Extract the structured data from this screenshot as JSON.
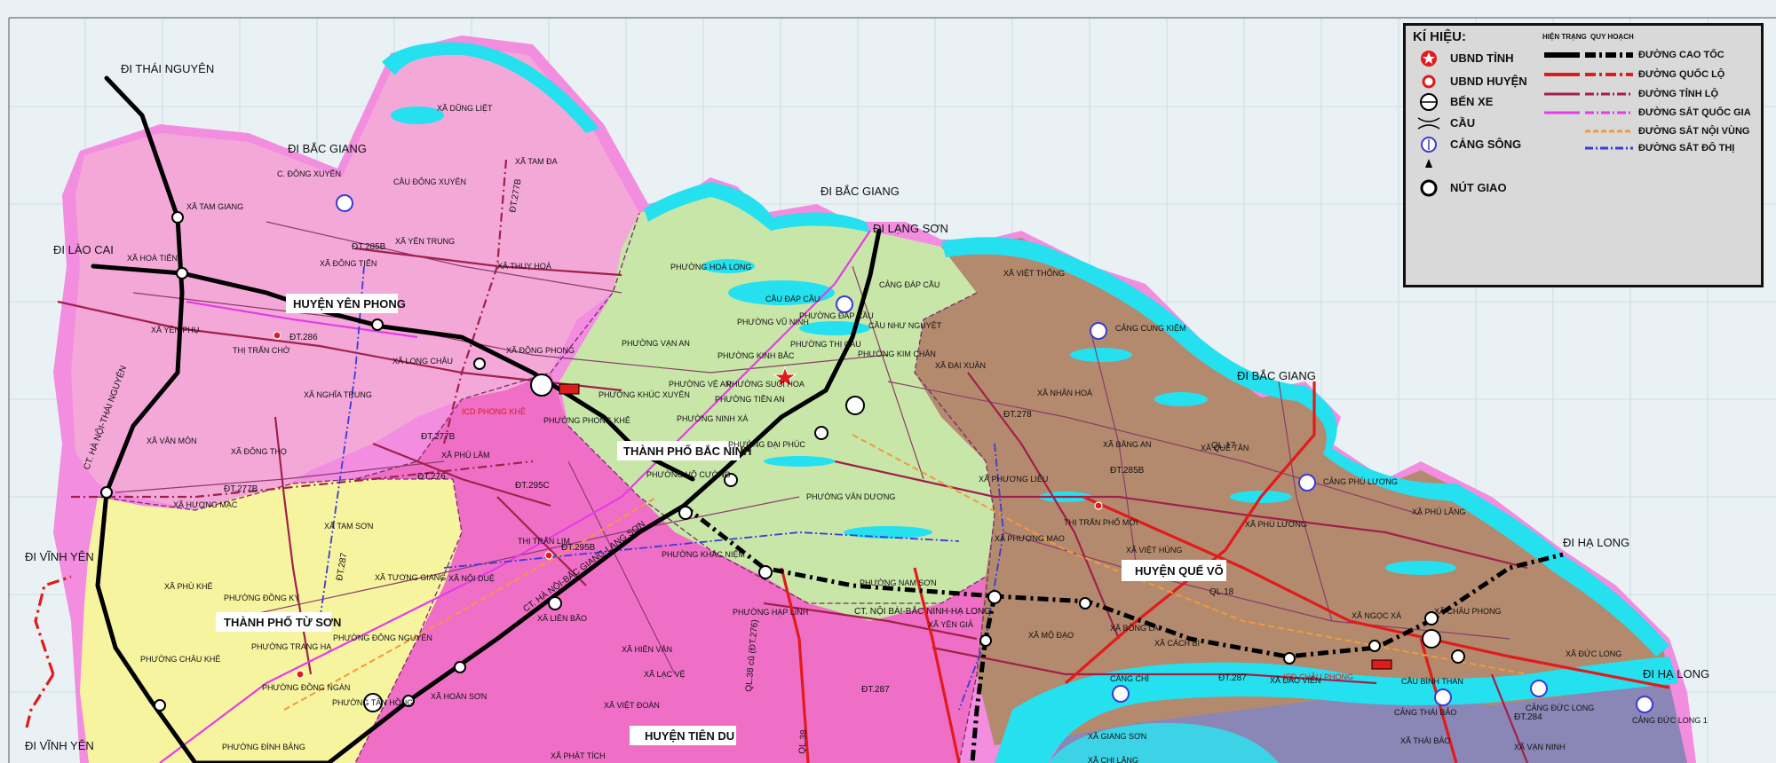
{
  "map": {
    "regions": {
      "yen_phong": "HUYỆN YÊN PHONG",
      "bac_ninh": "THÀNH PHỐ BẮC NINH",
      "tu_son": "THÀNH PHỐ TỪ SƠN",
      "que_vo": "HUYỆN QUẾ VÕ",
      "tien_du": "HUYỆN TIÊN DU"
    },
    "directions": {
      "thai_nguyen": "ĐI THÁI NGUYÊN",
      "bac_giang_1": "ĐI BẮC GIANG",
      "bac_giang_2": "ĐI BẮC GIANG",
      "lang_son": "ĐI LẠNG SƠN",
      "lao_cai": "ĐI LÀO CAI",
      "bac_giang_3": "ĐI BẮC GIANG",
      "vinh_yen_1": "ĐI VĨNH YÊN",
      "vinh_yen_2": "ĐI VĨNH YÊN",
      "ha_long_1": "ĐI HẠ LONG",
      "ha_long_2": "ĐI HẠ LONG"
    },
    "road_labels": {
      "ct_hn_tn": "CT. HÀ NỘI-THÁI NGUYÊN",
      "ct_hn_bg_ls": "CT. HÀ NỘI-BẮC GIANG-LẠNG SƠN",
      "ct_nb_bn_hl": "CT. NỘI BÀI-BẮC NINH-HẠ LONG",
      "dt285b_a": "ĐT.285B",
      "dt277b_a": "ĐT.277B",
      "dt286": "ĐT.286",
      "dt277b_b": "ĐT.277B",
      "dt277b_c": "ĐT.277B",
      "dt276": "ĐT.276",
      "dt295c": "ĐT.295C",
      "dt295b": "ĐT.295B",
      "dt287_a": "ĐT.287",
      "dt287_b": "ĐT.287",
      "dt287_c": "ĐT.287",
      "dt285b_b": "ĐT.285B",
      "dt278": "ĐT.278",
      "dt284": "ĐT.284",
      "ql38_a": "QL.38 cũ (ĐT.276)",
      "ql38_b": "QL.38",
      "ql17": "QL.17",
      "ql18": "QL.18"
    },
    "places": [
      "XÃ DŨNG LIỆT",
      "XÃ TAM ĐA",
      "XÃ TAM GIANG",
      "XÃ HOÀ TIẾN",
      "XÃ ĐÔNG TIẾN",
      "XÃ YÊN TRUNG",
      "XÃ THUỴ HOÀ",
      "XÃ YÊN PHỤ",
      "THỊ TRẤN CHỜ",
      "XÃ LONG CHÂU",
      "XÃ ĐÔNG PHONG",
      "XÃ NGHĨA TRUNG",
      "XÃ VĂN MÔN",
      "XÃ ĐÔNG THỌ",
      "XÃ HƯƠNG MẠC",
      "XÃ PHÙ KHÊ",
      "XÃ TAM SƠN",
      "XÃ TƯƠNG GIANG",
      "PHƯỜNG ĐỒNG KỴ",
      "PHƯỜNG TRANG HẠ",
      "PHƯỜNG CHÂU KHÊ",
      "PHƯỜNG ĐÌNH BẢNG",
      "PHƯỜNG ĐỒNG NGÀN",
      "PHƯỜNG TÂN HỒNG",
      "PHƯỜNG ĐÔNG NGUYÊN",
      "XÃ HOÀN SƠN",
      "XÃ PHÚ LÂM",
      "THỊ TRẤN LIM",
      "XÃ NỘI DUỆ",
      "XÃ LIÊN BÃO",
      "XÃ HIÊN VÂN",
      "XÃ LẠC VỆ",
      "XÃ VIỆT ĐOÀN",
      "XÃ PHẬT TÍCH",
      "PHƯỜNG HOÀ LONG",
      "PHƯỜNG VẠN AN",
      "PHƯỜNG VŨ NINH",
      "PHƯỜNG KINH BẮC",
      "PHƯỜNG KHÚC XUYÊN",
      "PHƯỜNG VỆ AN",
      "PHƯỜNG SUỐI HOA",
      "PHƯỜNG TIỀN AN",
      "PHƯỜNG NINH XÁ",
      "PHƯỜNG PHONG KHÊ",
      "PHƯỜNG THỊ CẦU",
      "PHƯỜNG ĐÁP CẦU",
      "PHƯỜNG KIM CHÂN",
      "PHƯỜNG ĐẠI PHÚC",
      "PHƯỜNG VÕ CƯỜNG",
      "PHƯỜNG VÂN DƯƠNG",
      "PHƯỜNG KHẮC NIỆM",
      "PHƯỜNG NAM SƠN",
      "PHƯỜNG HẠP LĨNH",
      "XÃ VIỆT THỐNG",
      "XÃ ĐẠI XUÂN",
      "XÃ NHÂN HOÀ",
      "XÃ BẰNG AN",
      "XÃ QUẾ TÂN",
      "XÃ PHƯƠNG LIỄU",
      "THỊ TRẤN PHỐ MỚI",
      "XÃ PHÙ LƯƠNG",
      "XÃ PHÙ LÃNG",
      "XÃ VIỆT HÙNG",
      "XÃ PHƯỢNG MAO",
      "XÃ NGỌC XÁ",
      "XÃ CHÂU PHONG",
      "XÃ ĐỨC LONG",
      "XÃ BỒNG LAI",
      "XÃ CÁCH BI",
      "XÃ MỘ ĐẠO",
      "XÃ YÊN GIẢ",
      "XÃ ĐÀO VIÊN",
      "XÃ GIANG SƠN",
      "XÃ THÁI BẢO",
      "XÃ VẠN NINH",
      "XÃ CHI LĂNG"
    ],
    "ports": {
      "dap_cau": "CẢNG ĐÁP CẦU",
      "cung_kiem": "CẢNG CUNG KIỆM",
      "phu_luong": "CẢNG PHÙ LƯƠNG",
      "chi": "CẢNG CHÌ",
      "chau_phong": "ICD CHÂU PHONG",
      "thai_bao": "CẢNG THÁI BẢO",
      "duc_long": "CẢNG ĐỨC LONG",
      "duc_long_1": "CẢNG ĐỨC LONG 1",
      "binh_than": "CẦU BÌNH THAN",
      "icd_phong_khe": "ICD PHONG KHÊ",
      "c_dong_xuyen": "C. ĐÔNG XUYÊN",
      "cau_dong_xuyen": "CẦU ĐÔNG XUYÊN",
      "cau_dap_cau": "CẦU ĐÁP CẦU",
      "cau_nhu_nguyet": "CẦU NHƯ NGUYỆT"
    }
  },
  "legend": {
    "title": "KÍ HIỆU:",
    "col_current": "HIỆN TRẠNG",
    "col_planned": "QUY HOẠCH",
    "points": [
      "UBND TỈNH",
      "UBND HUYỆN",
      "BẾN XE",
      "CẦU",
      "CẢNG SÔNG",
      "",
      "NÚT GIAO"
    ],
    "lines": [
      "ĐƯỜNG CAO TỐC",
      "ĐƯỜNG QUỐC LỘ",
      "ĐƯỜNG TỈNH LỘ",
      "ĐƯỜNG SẮT QUỐC GIA",
      "ĐƯỜNG SẮT NỘI VÙNG",
      "ĐƯỜNG SẮT ĐÔ THỊ"
    ],
    "colors": {
      "expressway": "#000000",
      "national": "#e11b1b",
      "provincial": "#a0204a",
      "rail_national": "#e43de8",
      "rail_regional": "#f19a3a",
      "rail_urban": "#3b3bd6"
    }
  },
  "colors": {
    "yen_phong": "#f4a8d8",
    "bac_ninh": "#c8e6a8",
    "tu_son": "#f7f4a0",
    "tien_du": "#ef6fc6",
    "que_vo": "#b38a6e",
    "water": "#25e0ef",
    "halo": "#f28de0",
    "gia_binh": "#8a86b5"
  }
}
